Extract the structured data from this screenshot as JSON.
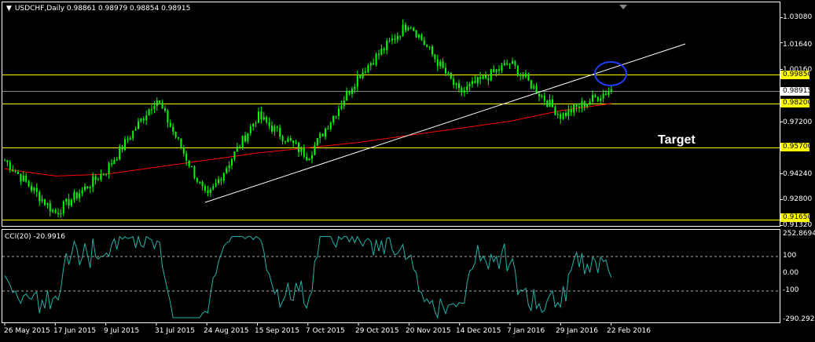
{
  "header": {
    "symbol_line": "USDCHF,Daily  0.98861 0.98979 0.98854 0.98915"
  },
  "annotation": {
    "target_text": "Target"
  },
  "indicator": {
    "label": "CCI(20) -20.9916",
    "scale_labels": [
      "252.8694",
      "100",
      "0.00",
      "-100",
      "-290.2926"
    ]
  },
  "price_axis": {
    "labels": [
      "1.03080",
      "1.01640",
      "1.00160",
      "0.98915",
      "0.98200",
      "0.97200",
      "0.95700",
      "0.94240",
      "0.92800",
      "0.91650",
      "0.91320"
    ]
  },
  "levels": {
    "yellow": [
      "0.99850",
      "0.98200",
      "0.95700",
      "0.91650"
    ],
    "current": "0.98915"
  },
  "time_axis": {
    "labels": [
      "26 May 2015",
      "17 Jun 2015",
      "9 Jul 2015",
      "31 Jul 2015",
      "24 Aug 2015",
      "15 Sep 2015",
      "7 Oct 2015",
      "29 Oct 2015",
      "20 Nov 2015",
      "14 Dec 2015",
      "7 Jan 2016",
      "29 Jan 2016",
      "22 Feb 2016"
    ]
  },
  "colors": {
    "background": "#000000",
    "candles": "#00ff00",
    "moving_average": "#ff0000",
    "trendline": "#ffffff",
    "levels": "#ffff00",
    "cci": "#20b2aa",
    "ellipse": "#0000ff"
  },
  "chart_data": {
    "type": "line",
    "title": "USDCHF,Daily",
    "ohlc_last": {
      "open": 0.98861,
      "high": 0.98979,
      "low": 0.98854,
      "close": 0.98915
    },
    "x": [
      "26 May 2015",
      "17 Jun 2015",
      "9 Jul 2015",
      "31 Jul 2015",
      "24 Aug 2015",
      "15 Sep 2015",
      "7 Oct 2015",
      "29 Oct 2015",
      "20 Nov 2015",
      "14 Dec 2015",
      "7 Jan 2016",
      "29 Jan 2016",
      "22 Feb 2016"
    ],
    "series": [
      {
        "values": [
          0.95,
          0.92,
          0.944,
          0.985,
          0.928,
          0.975,
          0.952,
          0.998,
          1.028,
          0.988,
          1.005,
          0.975,
          0.99
        ]
      },
      {
        "values": [
          0.945,
          0.941,
          0.942,
          0.946,
          0.95,
          0.954,
          0.957,
          0.96,
          0.964,
          0.968,
          0.972,
          0.978,
          0.982
        ]
      }
    ],
    "horizontal_levels": [
      0.9985,
      0.982,
      0.957,
      0.9165
    ],
    "ylim": [
      0.9132,
      1.0308
    ],
    "indicator": {
      "name": "CCI(20)",
      "last": -20.9916,
      "levels": [
        100,
        -100
      ],
      "ylim": [
        -290.2926,
        252.8694
      ]
    }
  }
}
